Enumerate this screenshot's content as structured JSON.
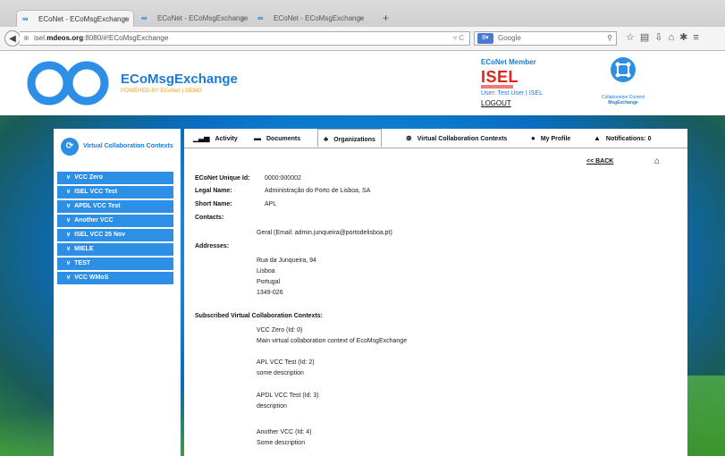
{
  "browser": {
    "tabs": [
      {
        "title": "ECoNet - ECoMsgExchange"
      },
      {
        "title": "ECoNet - ECoMsgExchange"
      },
      {
        "title": "ECoNet - ECoMsgExchange"
      }
    ],
    "new_tab": "+",
    "url_plain": "isel.",
    "url_bold": "mdeos.org",
    "url_rest": ":8080/#!ECoMsgExchange",
    "search_placeholder": "Google"
  },
  "header": {
    "brand": "ECoMsgExchange",
    "subtitle": "POWERED BY ECoNet | DEMO",
    "member_label": "ECoNet Member",
    "institution": "ISEL",
    "user": "User: Test User | ISEL",
    "logout": "LOGOUT",
    "context_label": "Collaboration Context",
    "context_name": "MsgExchange"
  },
  "sidebar": {
    "title": "Virtual Collaboration Contexts",
    "items": [
      {
        "label": "VCC Zero"
      },
      {
        "label": "ISEL VCC Test"
      },
      {
        "label": "APDL VCC Test"
      },
      {
        "label": "Another VCC"
      },
      {
        "label": "ISEL VCC 25 Nov"
      },
      {
        "label": "MIELE"
      },
      {
        "label": "TEST"
      },
      {
        "label": "VCC WMoS"
      }
    ]
  },
  "nav_tabs": [
    {
      "label": "Activity"
    },
    {
      "label": "Documents"
    },
    {
      "label": "Organizations"
    },
    {
      "label": "Virtual Collaboration Contexts"
    },
    {
      "label": "My Profile"
    },
    {
      "label": "Notifications: 0"
    }
  ],
  "actions": {
    "back": "<< BACK"
  },
  "org": {
    "uid_label": "ECoNet Unique Id:",
    "uid": "0000:000002",
    "legal_label": "Legal Name:",
    "legal": "Administração do Porto de Lisboa, SA",
    "short_label": "Short Name:",
    "short": "APL",
    "contacts_label": "Contacts:",
    "contact": "Geral (Email: admin.junqueira@portodelisboa.pt)",
    "addresses_label": "Addresses:",
    "address": [
      "Rua da Junqueira, 94",
      "Lisboa",
      "Portugal",
      "1349-026"
    ],
    "subscribed_label": "Subscribed Virtual Collaboration Contexts:",
    "vccs": [
      {
        "name": "VCC Zero (Id: 0)",
        "desc": "Main virtual collaboration context of EcoMsgExchange"
      },
      {
        "name": "APL VCC Test (Id: 2)",
        "desc": "some description"
      },
      {
        "name": "APDL VCC Test (Id: 3)",
        "desc": "description"
      },
      {
        "name": "Another VCC (Id: 4)",
        "desc": "Some description"
      }
    ]
  }
}
